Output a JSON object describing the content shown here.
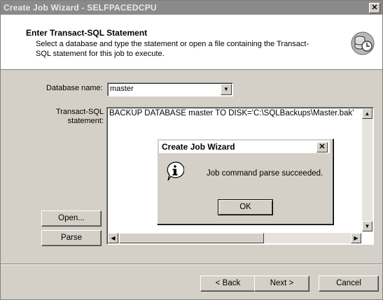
{
  "window": {
    "title": "Create Job Wizard - SELFPACEDCPU",
    "close_glyph": "✕"
  },
  "header": {
    "title": "Enter Transact-SQL Statement",
    "description": "Select a database and type the statement or open a file containing the Transact-SQL statement for this job to execute.",
    "icon": "sql-statement-wizard-icon"
  },
  "form": {
    "database_label": "Database name:",
    "database_value": "master",
    "statement_label_line1": "Transact-SQL",
    "statement_label_line2": "statement:",
    "statement_text": "BACKUP DATABASE master TO DISK='C:\\SQLBackups\\Master.bak'"
  },
  "buttons": {
    "open": "Open...",
    "parse": "Parse",
    "back": "< Back",
    "next": "Next >",
    "cancel": "Cancel"
  },
  "dialog": {
    "title": "Create Job Wizard",
    "message": "Job command parse succeeded.",
    "ok": "OK",
    "close_glyph": "✕",
    "icon": "information-icon"
  },
  "colors": {
    "title_bar": "#8a8a8a",
    "face": "#d4d0c8"
  }
}
